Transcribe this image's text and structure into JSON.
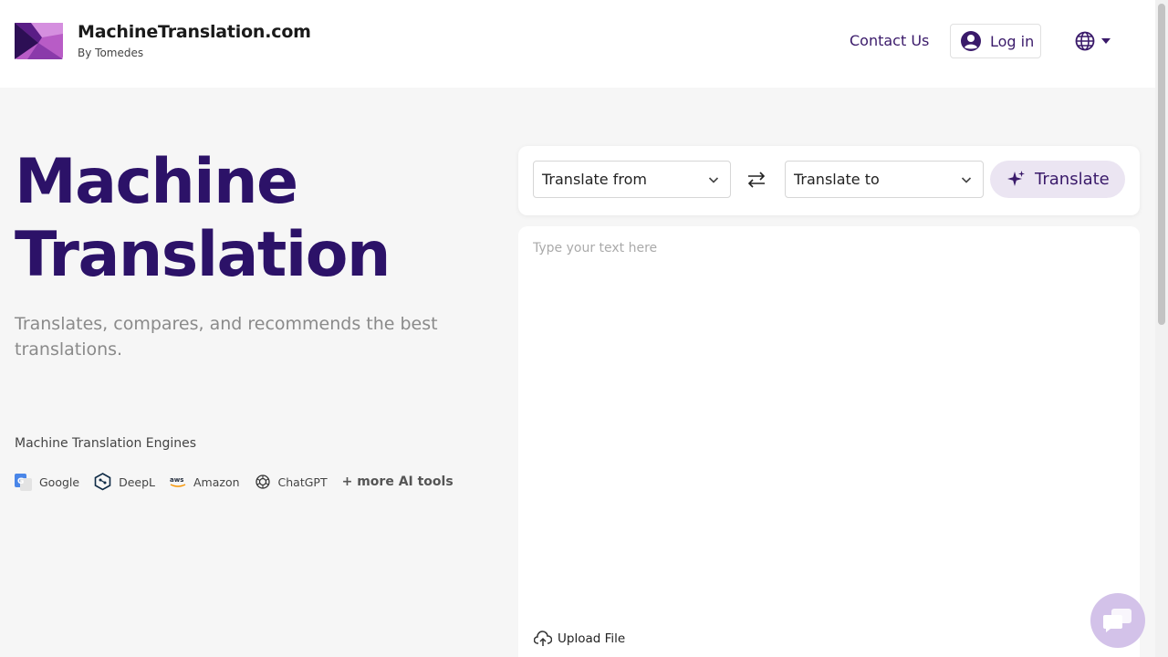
{
  "header": {
    "brand_name": "MachineTranslation.com",
    "brand_sub": "By Tomedes",
    "contact_label": "Contact Us",
    "login_label": "Log in",
    "globe_icon": "globe-icon"
  },
  "hero": {
    "title_line1": "Machine",
    "title_line2": "Translation",
    "subtitle": "Translates, compares, and recommends the best translations."
  },
  "engines": {
    "label": "Machine Translation Engines",
    "items": [
      {
        "name": "Google",
        "icon": "google-translate-icon"
      },
      {
        "name": "DeepL",
        "icon": "deepl-icon"
      },
      {
        "name": "Amazon",
        "icon": "aws-icon"
      },
      {
        "name": "ChatGPT",
        "icon": "chatgpt-icon"
      }
    ],
    "more_label": "+ more AI tools"
  },
  "toolbar": {
    "from_label": "Translate from",
    "to_label": "Translate to",
    "translate_label": "Translate"
  },
  "editor": {
    "placeholder": "Type your text here",
    "upload_label": "Upload File"
  },
  "colors": {
    "brand_purple": "#2c1268",
    "accent_purple": "#3a1a6a",
    "translate_bg": "#ebe5f2",
    "chat_bg": "#d3c2e9"
  }
}
